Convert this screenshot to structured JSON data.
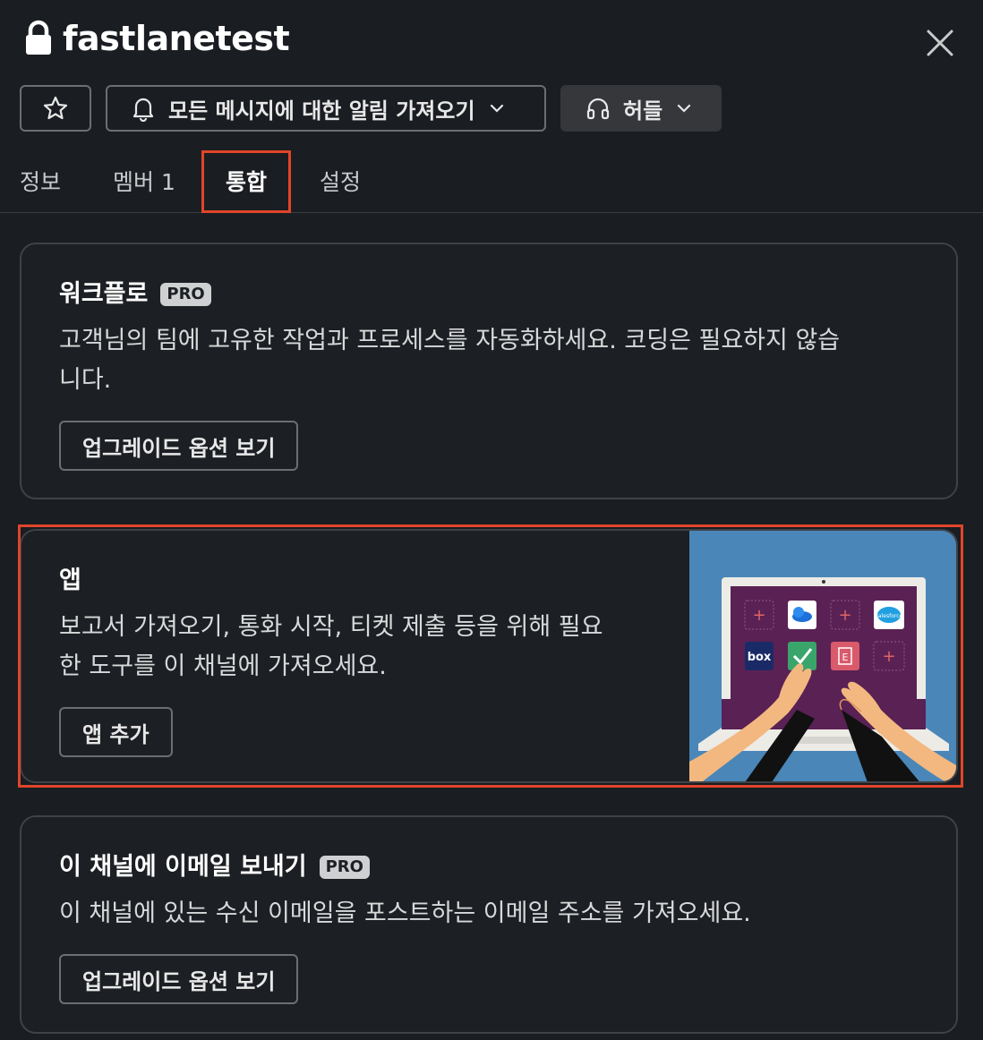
{
  "header": {
    "title": "fastlanetest",
    "icons": {
      "lock": "lock-icon",
      "close": "close-icon"
    }
  },
  "controls": {
    "star": {
      "icon": "star-icon"
    },
    "notifications": {
      "label": "모든 메시지에 대한 알림 가져오기",
      "icon": "bell-icon"
    },
    "huddle": {
      "label": "허들",
      "icon": "headphones-icon"
    }
  },
  "tabs": [
    {
      "label": "정보",
      "count": ""
    },
    {
      "label": "멤버",
      "count": "1"
    },
    {
      "label": "통합",
      "count": "",
      "active": true
    },
    {
      "label": "설정",
      "count": ""
    }
  ],
  "cards": {
    "workflow": {
      "title": "워크플로",
      "badge": "PRO",
      "desc_line1": "고객님의 팀에 고유한 작업과 프로세스를 자동화하세요. 코딩은 필요하지 않습",
      "desc_line2": "니다.",
      "button": "업그레이드 옵션 보기"
    },
    "apps": {
      "title": "앱",
      "desc_line1": "보고서 가져오기, 통화 시작, 티켓 제출 등을 위해 필요",
      "desc_line2": "한 도구를 이 채널에 가져오세요.",
      "button": "앱 추가",
      "illustration_labels": {
        "box": "box",
        "salesforce": "salesforce"
      }
    },
    "email": {
      "title": "이 채널에 이메일 보내기",
      "badge": "PRO",
      "desc": "이 채널에 있는 수신 이메일을 포스트하는 이메일 주소를 가져오세요.",
      "button": "업그레이드 옵션 보기"
    }
  },
  "colors": {
    "background": "#1a1d21",
    "card_border": "#3f4247",
    "highlight": "#e0452a",
    "illustration_bg": "#4a86b8"
  }
}
